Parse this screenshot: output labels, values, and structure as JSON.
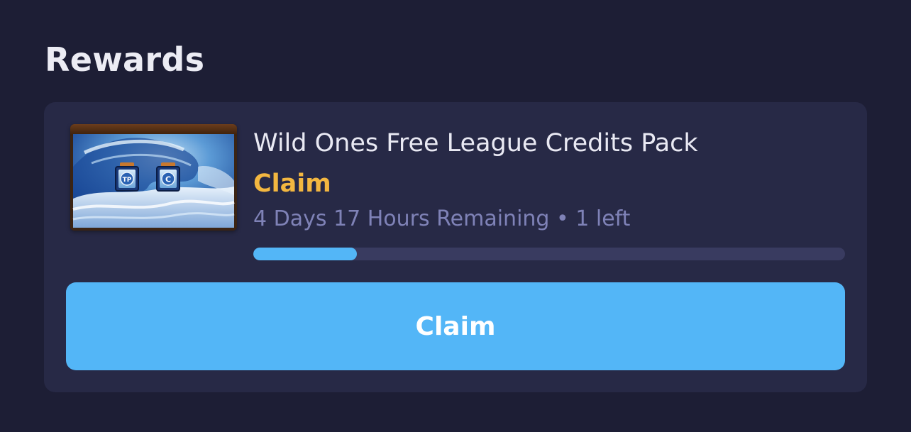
{
  "section": {
    "title": "Rewards"
  },
  "reward": {
    "title": "Wild Ones Free League Credits Pack",
    "status": "Claim",
    "remaining_text": "4 Days 17 Hours Remaining • 1 left",
    "progress_fraction": 0.175,
    "thumbnail_icons": [
      "tp-badge-icon",
      "credits-badge-icon"
    ],
    "claim_button_label": "Claim"
  },
  "colors": {
    "background": "#1d1e35",
    "card": "#272946",
    "status_accent": "#f3b740",
    "progress_fill": "#53b6f7",
    "progress_track": "#393b60",
    "button": "#53b6f7",
    "muted_text": "#7f82b7"
  }
}
